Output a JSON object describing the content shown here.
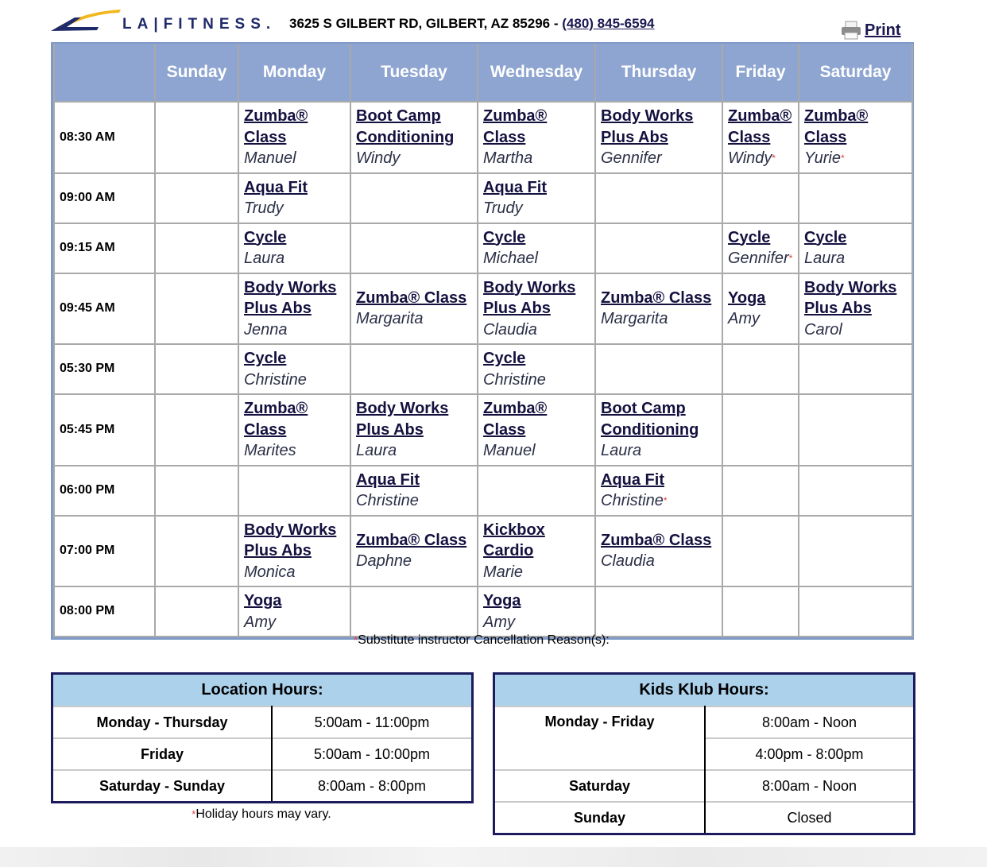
{
  "header": {
    "brand": "LA|FITNESS.",
    "address": "3625 S GILBERT RD, GILBERT, AZ 85296 - ",
    "phone": "(480) 845-6594",
    "print_label": "Print",
    "colors": {
      "brand_blue": "#1f2a6b",
      "brand_yellow": "#f2b71f"
    }
  },
  "schedule": {
    "days": [
      "",
      "Sunday",
      "Monday",
      "Tuesday",
      "Wednesday",
      "Thursday",
      "Friday",
      "Saturday"
    ],
    "rows": [
      {
        "time": "08:30 AM",
        "cells": [
          null,
          {
            "class": "Zumba® Class",
            "instructor": "Manuel"
          },
          {
            "class": "Boot Camp Conditioning",
            "instructor": "Windy"
          },
          {
            "class": "Zumba® Class",
            "instructor": "Martha"
          },
          {
            "class": "Body Works Plus Abs",
            "instructor": "Gennifer"
          },
          {
            "class": "Zumba® Class",
            "instructor": "Windy",
            "sub": true
          },
          {
            "class": "Zumba® Class",
            "instructor": "Yurie",
            "sub": true
          }
        ]
      },
      {
        "time": "09:00 AM",
        "cells": [
          null,
          {
            "class": "Aqua Fit",
            "instructor": "Trudy"
          },
          null,
          {
            "class": "Aqua Fit",
            "instructor": "Trudy"
          },
          null,
          null,
          null
        ]
      },
      {
        "time": "09:15 AM",
        "cells": [
          null,
          {
            "class": "Cycle",
            "instructor": "Laura"
          },
          null,
          {
            "class": "Cycle",
            "instructor": "Michael"
          },
          null,
          {
            "class": "Cycle",
            "instructor": "Gennifer",
            "sub": true
          },
          {
            "class": "Cycle",
            "instructor": "Laura"
          }
        ]
      },
      {
        "time": "09:45 AM",
        "cells": [
          null,
          {
            "class": "Body Works Plus Abs",
            "instructor": "Jenna"
          },
          {
            "class": "Zumba® Class",
            "instructor": "Margarita"
          },
          {
            "class": "Body Works Plus Abs",
            "instructor": "Claudia"
          },
          {
            "class": "Zumba® Class",
            "instructor": "Margarita"
          },
          {
            "class": "Yoga",
            "instructor": "Amy"
          },
          {
            "class": "Body Works Plus Abs",
            "instructor": "Carol"
          }
        ]
      },
      {
        "time": "05:30 PM",
        "cells": [
          null,
          {
            "class": "Cycle",
            "instructor": "Christine"
          },
          null,
          {
            "class": "Cycle",
            "instructor": "Christine"
          },
          null,
          null,
          null
        ]
      },
      {
        "time": "05:45 PM",
        "cells": [
          null,
          {
            "class": "Zumba® Class",
            "instructor": "Marites"
          },
          {
            "class": "Body Works Plus Abs",
            "instructor": "Laura"
          },
          {
            "class": "Zumba® Class",
            "instructor": "Manuel"
          },
          {
            "class": "Boot Camp Conditioning",
            "instructor": "Laura"
          },
          null,
          null
        ]
      },
      {
        "time": "06:00 PM",
        "cells": [
          null,
          null,
          {
            "class": "Aqua Fit",
            "instructor": "Christine"
          },
          null,
          {
            "class": "Aqua Fit",
            "instructor": "Christine",
            "sub": true
          },
          null,
          null
        ]
      },
      {
        "time": "07:00 PM",
        "cells": [
          null,
          {
            "class": "Body Works Plus Abs",
            "instructor": "Monica"
          },
          {
            "class": "Zumba® Class",
            "instructor": "Daphne"
          },
          {
            "class": "Kickbox Cardio",
            "instructor": "Marie"
          },
          {
            "class": "Zumba® Class",
            "instructor": "Claudia"
          },
          null,
          null
        ]
      },
      {
        "time": "08:00 PM",
        "cells": [
          null,
          {
            "class": "Yoga",
            "instructor": "Amy"
          },
          null,
          {
            "class": "Yoga",
            "instructor": "Amy"
          },
          null,
          null,
          null
        ]
      }
    ],
    "footnote_mark": "*",
    "footnote": "Substitute instructor Cancellation Reason(s):",
    "colors": {
      "header_bg": "#8ea5d1",
      "link": "#14113f",
      "sub_mark": "#e04040"
    }
  },
  "location_hours": {
    "title": "Location Hours:",
    "rows": [
      {
        "day": "Monday - Thursday",
        "hours": "5:00am - 11:00pm"
      },
      {
        "day": "Friday",
        "hours": "5:00am - 10:00pm"
      },
      {
        "day": "Saturday - Sunday",
        "hours": "8:00am - 8:00pm"
      }
    ],
    "note_mark": "*",
    "note": "Holiday hours may vary."
  },
  "kids_hours": {
    "title": "Kids Klub Hours:",
    "rows": [
      {
        "day": "Monday - Friday",
        "hours": "8:00am - Noon"
      },
      {
        "day": "",
        "hours": "4:00pm - 8:00pm"
      },
      {
        "day": "Saturday",
        "hours": "8:00am - Noon"
      },
      {
        "day": "Sunday",
        "hours": "Closed"
      }
    ]
  }
}
